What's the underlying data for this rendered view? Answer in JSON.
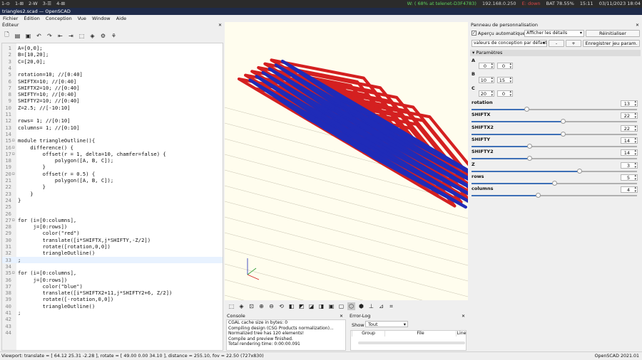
{
  "system_bar": {
    "workspaces": [
      "1-⊙",
      "1-⊞",
      "2-W",
      "3-☰",
      "4-⊞"
    ],
    "wifi": "W: ( 68% at telenet-D3F4783)",
    "ip": "192.168.0.250",
    "eth": "E: down",
    "battery": "BAT 78.55%",
    "time": "15:11",
    "date": "03/11/2023 18:04"
  },
  "window_title": "triangles2.scad — OpenSCAD",
  "menu": [
    "Fichier",
    "Édition",
    "Conception",
    "Vue",
    "Window",
    "Aide"
  ],
  "editor": {
    "title": "Éditeur",
    "lines": [
      {
        "n": "1",
        "t": "A=[0,0];"
      },
      {
        "n": "2",
        "t": "B=[10,20];"
      },
      {
        "n": "3",
        "t": "C=[20,0];"
      },
      {
        "n": "4",
        "t": ""
      },
      {
        "n": "5",
        "t": "rotation=10; //[0:40]"
      },
      {
        "n": "6",
        "t": "SHIFTX=10; //[0:40]"
      },
      {
        "n": "7",
        "t": "SHIFTX2=10; //[0:40]"
      },
      {
        "n": "8",
        "t": "SHIFTY=10; //[0:40]"
      },
      {
        "n": "9",
        "t": "SHIFTY2=10; //[0:40]"
      },
      {
        "n": "10",
        "t": "Z=2.5; //[-10:10]"
      },
      {
        "n": "11",
        "t": ""
      },
      {
        "n": "12",
        "t": "rows= 1; //[0:10]"
      },
      {
        "n": "13",
        "t": "columns= 1; //[0:10]"
      },
      {
        "n": "14",
        "t": ""
      },
      {
        "n": "15",
        "t": "module triangleOutline(){"
      },
      {
        "n": "16",
        "t": "    difference() {"
      },
      {
        "n": "17",
        "t": "        offset(r = 1, delta=10, chamfer=false) {"
      },
      {
        "n": "18",
        "t": "            polygon([A, B, C]);"
      },
      {
        "n": "19",
        "t": "        }"
      },
      {
        "n": "20",
        "t": "        offset(r = 0.5) {"
      },
      {
        "n": "21",
        "t": "            polygon([A, B, C]);"
      },
      {
        "n": "22",
        "t": "        }"
      },
      {
        "n": "23",
        "t": "    }"
      },
      {
        "n": "24",
        "t": "}"
      },
      {
        "n": "25",
        "t": ""
      },
      {
        "n": "26",
        "t": ""
      },
      {
        "n": "27",
        "t": "for (i=[0:columns],"
      },
      {
        "n": "28",
        "t": "     j=[0:rows])"
      },
      {
        "n": "29",
        "t": "        color(\"red\")"
      },
      {
        "n": "30",
        "t": "        translate([i*SHIFTX,j*SHIFTY,-Z/2])"
      },
      {
        "n": "31",
        "t": "        rotate([rotation,0,0])"
      },
      {
        "n": "32",
        "t": "        triangleOutline()"
      },
      {
        "n": "33",
        "t": ";"
      },
      {
        "n": "34",
        "t": ""
      },
      {
        "n": "35",
        "t": "for (i=[0:columns],"
      },
      {
        "n": "36",
        "t": "     j=[0:rows])"
      },
      {
        "n": "37",
        "t": "        color(\"blue\")"
      },
      {
        "n": "38",
        "t": "        translate([i*SHIFTX2+11,j*SHIFTY2+6, Z/2])"
      },
      {
        "n": "39",
        "t": "        rotate([-rotation,0,0])"
      },
      {
        "n": "40",
        "t": "        triangleOutline()"
      },
      {
        "n": "41",
        "t": ";"
      },
      {
        "n": "42",
        "t": ""
      },
      {
        "n": "43",
        "t": ""
      },
      {
        "n": "44",
        "t": ""
      }
    ]
  },
  "console": {
    "title": "Console",
    "lines": [
      "CGAL cache size in bytes: 0",
      "Compiling design (CSG Products normalization)...",
      "Normalized tree has 120 elements!",
      "Compile and preview finished.",
      "Total rendering time: 0:00:00.091"
    ]
  },
  "error_log": {
    "title": "Error-Log",
    "show_label": "Show",
    "filter_value": "Tout",
    "columns": [
      "Group",
      "File",
      "Line"
    ]
  },
  "customizer": {
    "title": "Panneau de personnalisation",
    "auto_preview_label": "Aperçu automatique",
    "auto_preview_checked": true,
    "details_combo": "Afficher les détails",
    "reset_button": "Réinitialiser",
    "preset_combo": "valeurs de conception par défaut",
    "minus_button": "-",
    "plus_button": "+",
    "save_button": "Enregistrer jeu param.",
    "section_title": "Paramètres",
    "A": [
      "0",
      "0"
    ],
    "B": [
      "10",
      "15"
    ],
    "C": [
      "20",
      "0"
    ],
    "sliders": [
      {
        "name": "rotation",
        "value": "13",
        "fraction": 0.33
      },
      {
        "name": "SHIFTX",
        "value": "22",
        "fraction": 0.55
      },
      {
        "name": "SHIFTX2",
        "value": "22",
        "fraction": 0.55
      },
      {
        "name": "SHIFTY",
        "value": "14",
        "fraction": 0.35
      },
      {
        "name": "SHIFTY2",
        "value": "14",
        "fraction": 0.35
      },
      {
        "name": "Z",
        "value": "3",
        "fraction": 0.65
      },
      {
        "name": "rows",
        "value": "5",
        "fraction": 0.5
      },
      {
        "name": "columns",
        "value": "4",
        "fraction": 0.4
      }
    ]
  },
  "status_bar": {
    "viewport": "Viewport: translate = [ 64.12 25.31 -2.28 ], rotate = [ 49.00 0.00 34.10 ], distance = 255.10, fov = 22.50 (727x830)",
    "version": "OpenSCAD 2021.01"
  },
  "colors": {
    "red_part": "#d42020",
    "blue_part": "#1f2bb8",
    "viewport_bg": "#fffdee",
    "grid": "#c7c2b0"
  }
}
